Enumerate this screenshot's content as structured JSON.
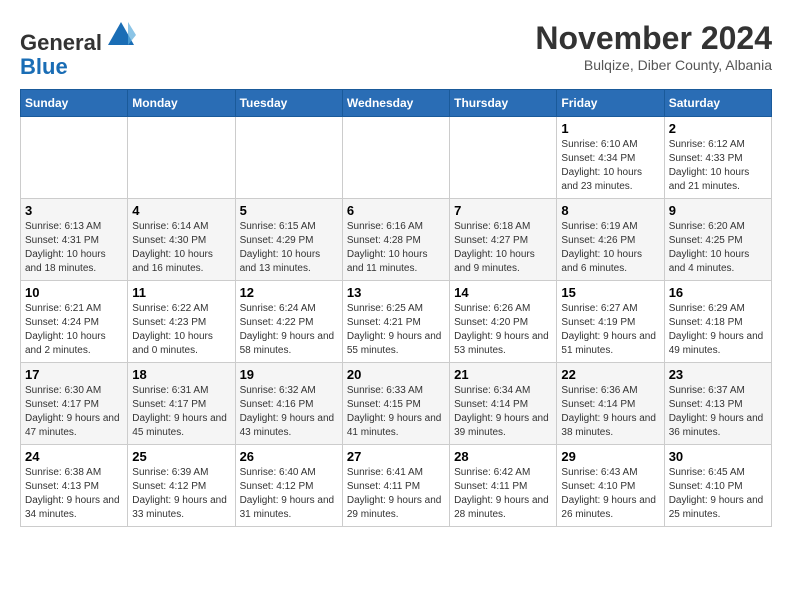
{
  "logo": {
    "general": "General",
    "blue": "Blue"
  },
  "header": {
    "month": "November 2024",
    "location": "Bulqize, Diber County, Albania"
  },
  "weekdays": [
    "Sunday",
    "Monday",
    "Tuesday",
    "Wednesday",
    "Thursday",
    "Friday",
    "Saturday"
  ],
  "weeks": [
    [
      {
        "day": "",
        "info": ""
      },
      {
        "day": "",
        "info": ""
      },
      {
        "day": "",
        "info": ""
      },
      {
        "day": "",
        "info": ""
      },
      {
        "day": "",
        "info": ""
      },
      {
        "day": "1",
        "info": "Sunrise: 6:10 AM\nSunset: 4:34 PM\nDaylight: 10 hours and 23 minutes."
      },
      {
        "day": "2",
        "info": "Sunrise: 6:12 AM\nSunset: 4:33 PM\nDaylight: 10 hours and 21 minutes."
      }
    ],
    [
      {
        "day": "3",
        "info": "Sunrise: 6:13 AM\nSunset: 4:31 PM\nDaylight: 10 hours and 18 minutes."
      },
      {
        "day": "4",
        "info": "Sunrise: 6:14 AM\nSunset: 4:30 PM\nDaylight: 10 hours and 16 minutes."
      },
      {
        "day": "5",
        "info": "Sunrise: 6:15 AM\nSunset: 4:29 PM\nDaylight: 10 hours and 13 minutes."
      },
      {
        "day": "6",
        "info": "Sunrise: 6:16 AM\nSunset: 4:28 PM\nDaylight: 10 hours and 11 minutes."
      },
      {
        "day": "7",
        "info": "Sunrise: 6:18 AM\nSunset: 4:27 PM\nDaylight: 10 hours and 9 minutes."
      },
      {
        "day": "8",
        "info": "Sunrise: 6:19 AM\nSunset: 4:26 PM\nDaylight: 10 hours and 6 minutes."
      },
      {
        "day": "9",
        "info": "Sunrise: 6:20 AM\nSunset: 4:25 PM\nDaylight: 10 hours and 4 minutes."
      }
    ],
    [
      {
        "day": "10",
        "info": "Sunrise: 6:21 AM\nSunset: 4:24 PM\nDaylight: 10 hours and 2 minutes."
      },
      {
        "day": "11",
        "info": "Sunrise: 6:22 AM\nSunset: 4:23 PM\nDaylight: 10 hours and 0 minutes."
      },
      {
        "day": "12",
        "info": "Sunrise: 6:24 AM\nSunset: 4:22 PM\nDaylight: 9 hours and 58 minutes."
      },
      {
        "day": "13",
        "info": "Sunrise: 6:25 AM\nSunset: 4:21 PM\nDaylight: 9 hours and 55 minutes."
      },
      {
        "day": "14",
        "info": "Sunrise: 6:26 AM\nSunset: 4:20 PM\nDaylight: 9 hours and 53 minutes."
      },
      {
        "day": "15",
        "info": "Sunrise: 6:27 AM\nSunset: 4:19 PM\nDaylight: 9 hours and 51 minutes."
      },
      {
        "day": "16",
        "info": "Sunrise: 6:29 AM\nSunset: 4:18 PM\nDaylight: 9 hours and 49 minutes."
      }
    ],
    [
      {
        "day": "17",
        "info": "Sunrise: 6:30 AM\nSunset: 4:17 PM\nDaylight: 9 hours and 47 minutes."
      },
      {
        "day": "18",
        "info": "Sunrise: 6:31 AM\nSunset: 4:17 PM\nDaylight: 9 hours and 45 minutes."
      },
      {
        "day": "19",
        "info": "Sunrise: 6:32 AM\nSunset: 4:16 PM\nDaylight: 9 hours and 43 minutes."
      },
      {
        "day": "20",
        "info": "Sunrise: 6:33 AM\nSunset: 4:15 PM\nDaylight: 9 hours and 41 minutes."
      },
      {
        "day": "21",
        "info": "Sunrise: 6:34 AM\nSunset: 4:14 PM\nDaylight: 9 hours and 39 minutes."
      },
      {
        "day": "22",
        "info": "Sunrise: 6:36 AM\nSunset: 4:14 PM\nDaylight: 9 hours and 38 minutes."
      },
      {
        "day": "23",
        "info": "Sunrise: 6:37 AM\nSunset: 4:13 PM\nDaylight: 9 hours and 36 minutes."
      }
    ],
    [
      {
        "day": "24",
        "info": "Sunrise: 6:38 AM\nSunset: 4:13 PM\nDaylight: 9 hours and 34 minutes."
      },
      {
        "day": "25",
        "info": "Sunrise: 6:39 AM\nSunset: 4:12 PM\nDaylight: 9 hours and 33 minutes."
      },
      {
        "day": "26",
        "info": "Sunrise: 6:40 AM\nSunset: 4:12 PM\nDaylight: 9 hours and 31 minutes."
      },
      {
        "day": "27",
        "info": "Sunrise: 6:41 AM\nSunset: 4:11 PM\nDaylight: 9 hours and 29 minutes."
      },
      {
        "day": "28",
        "info": "Sunrise: 6:42 AM\nSunset: 4:11 PM\nDaylight: 9 hours and 28 minutes."
      },
      {
        "day": "29",
        "info": "Sunrise: 6:43 AM\nSunset: 4:10 PM\nDaylight: 9 hours and 26 minutes."
      },
      {
        "day": "30",
        "info": "Sunrise: 6:45 AM\nSunset: 4:10 PM\nDaylight: 9 hours and 25 minutes."
      }
    ]
  ]
}
